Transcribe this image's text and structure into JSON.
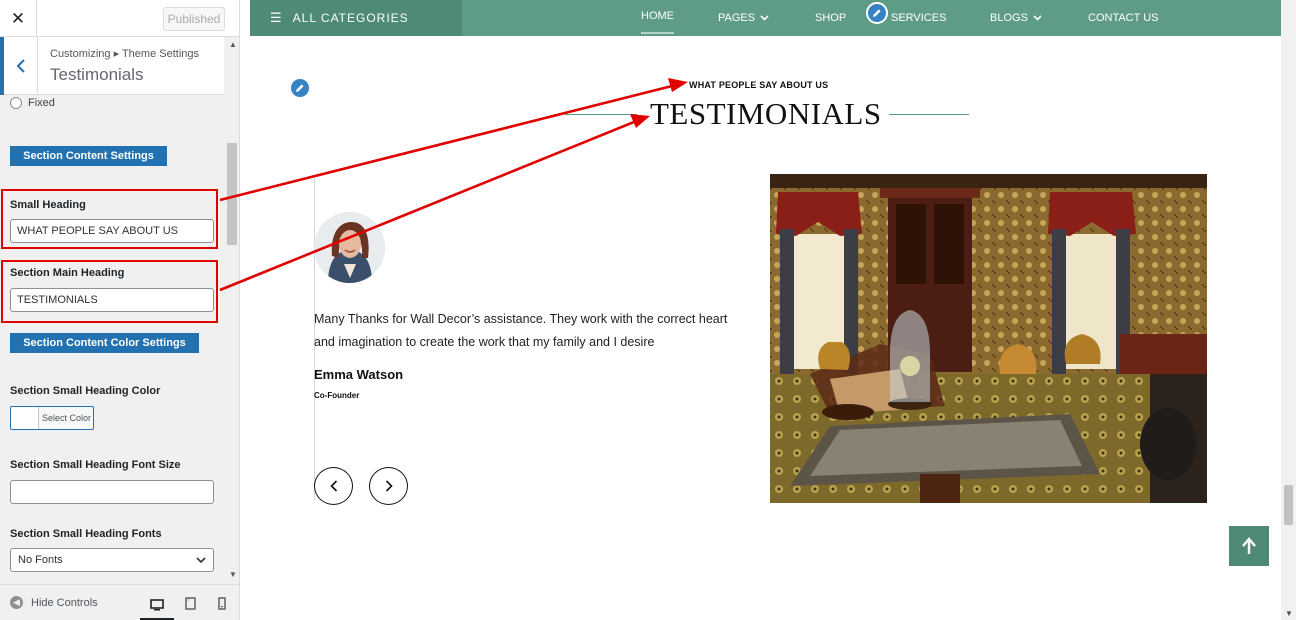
{
  "customizer": {
    "close_label": "✕",
    "published_label": "Published",
    "breadcrumb": "Customizing ▸ Theme Settings",
    "section_title": "Testimonials",
    "radio_fixed_label": "Fixed",
    "content_settings_label": "Section Content Settings",
    "small_heading_label": "Small Heading",
    "small_heading_value": "WHAT PEOPLE SAY ABOUT US",
    "main_heading_label": "Section Main Heading",
    "main_heading_value": "TESTIMONIALS",
    "color_settings_label": "Section Content Color Settings",
    "small_heading_color_label": "Section Small Heading Color",
    "select_color_label": "Select Color",
    "small_heading_font_size_label": "Section Small Heading Font Size",
    "small_heading_font_size_value": "",
    "small_heading_fonts_label": "Section Small Heading Fonts",
    "small_heading_fonts_value": "No Fonts",
    "hide_controls_label": "Hide Controls",
    "accent": "#2271b1"
  },
  "preview": {
    "nav": {
      "all_categories": "ALL CATEGORIES",
      "home": "HOME",
      "pages": "PAGES",
      "shop": "SHOP",
      "services": "SERVICES",
      "blogs": "BLOGS",
      "contact": "CONTACT US",
      "color": "#5e9c86"
    },
    "small_heading": "WHAT PEOPLE SAY ABOUT US",
    "main_heading": "TESTIMONIALS",
    "testimonial": {
      "quote": "Many Thanks for Wall Decor’s assistance. They work with the correct heart and imagination to create the work that my family and I desire",
      "name": "Emma Watson",
      "role": "Co-Founder"
    },
    "prev_icon": "chevron-left-icon",
    "next_icon": "chevron-right-icon"
  }
}
